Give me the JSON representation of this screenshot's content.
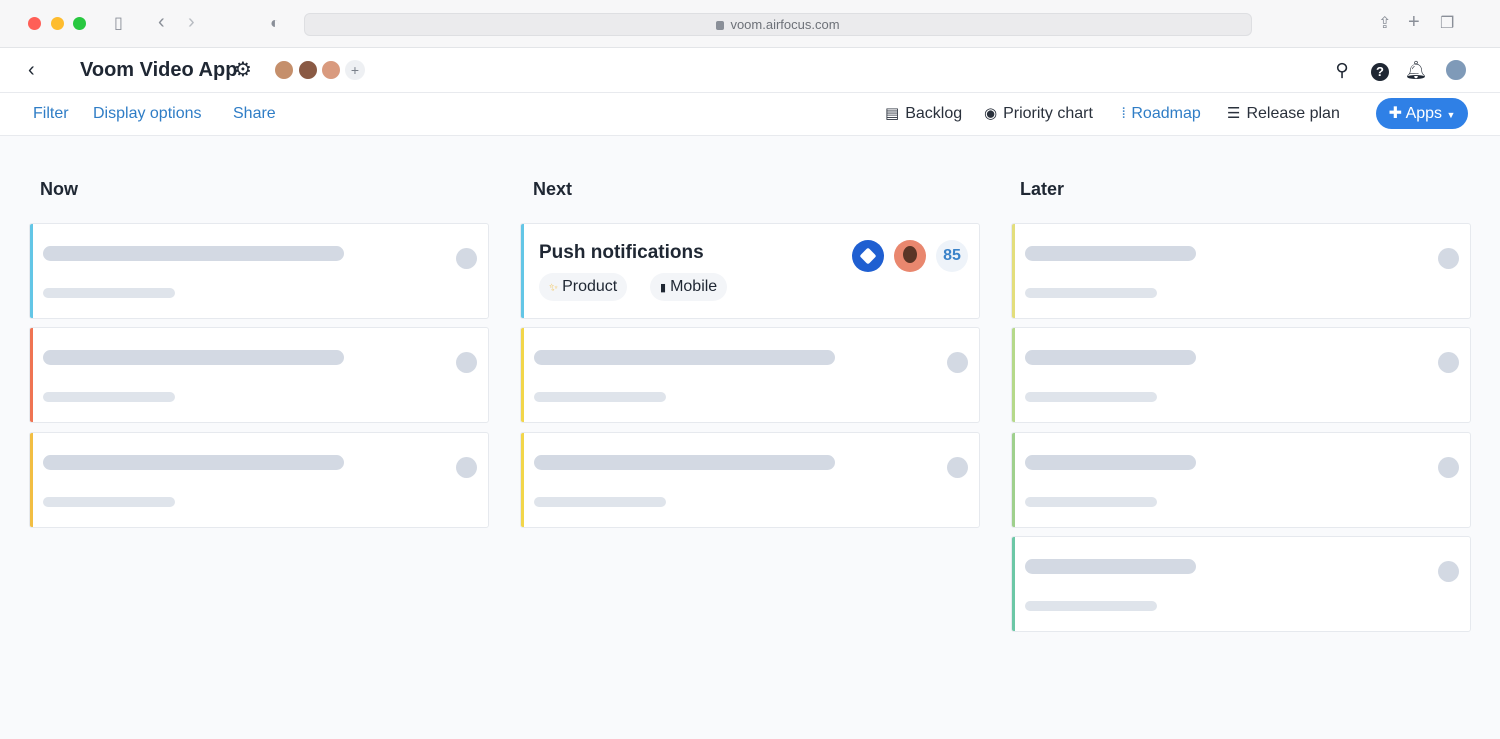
{
  "browser": {
    "url": "voom.airfocus.com"
  },
  "header": {
    "title": "Voom Video App",
    "add_label": "+"
  },
  "toolbar": {
    "filter": "Filter",
    "display_options": "Display options",
    "share": "Share",
    "views": {
      "backlog": "Backlog",
      "priority_chart": "Priority chart",
      "roadmap": "Roadmap",
      "release_plan": "Release plan"
    },
    "apps": "Apps"
  },
  "columns": {
    "now": {
      "title": "Now",
      "accents": [
        "#63c6e6",
        "#ef7453",
        "#f2be43"
      ]
    },
    "next": {
      "title": "Next",
      "accents": [
        "#63c6e6",
        "#f2d64a",
        "#f2d64a"
      ],
      "featured": {
        "title": "Push notifications",
        "tags": [
          {
            "icon": "sparkle-icon",
            "label": "Product"
          },
          {
            "icon": "phone-icon",
            "label": "Mobile"
          }
        ],
        "score": "85"
      }
    },
    "later": {
      "title": "Later",
      "accents": [
        "#e3de7c",
        "#b5d98a",
        "#9fd08d",
        "#6cc7a6"
      ]
    }
  },
  "colors": {
    "accent_blue": "#2f80e6",
    "link_blue": "#2f7dc6",
    "skeleton": "#d3d9e3"
  }
}
